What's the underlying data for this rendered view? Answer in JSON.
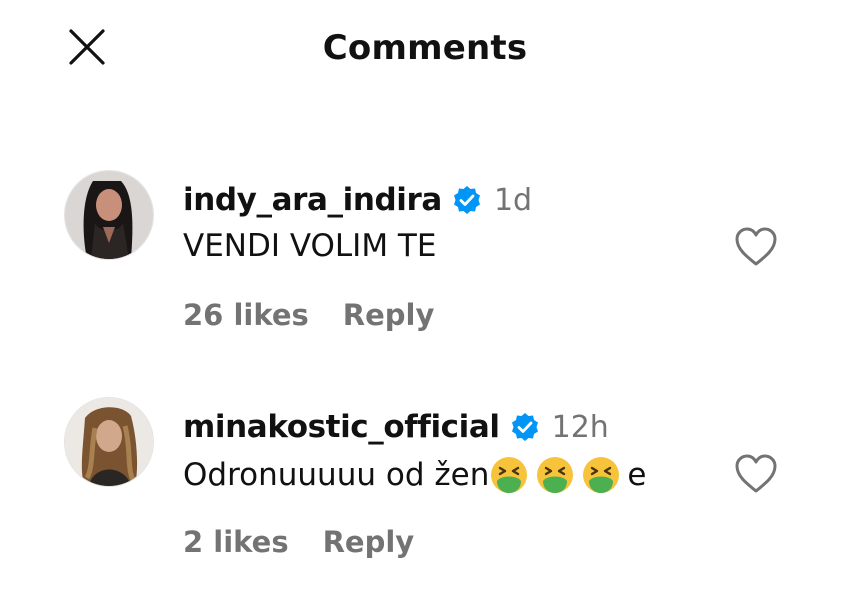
{
  "header": {
    "title": "Comments",
    "close_icon": "close-icon"
  },
  "comments": [
    {
      "username": "indy_ara_indira",
      "verified": true,
      "time": "1d",
      "text": "VENDI VOLIM TE",
      "likes": "26 likes",
      "reply_label": "Reply",
      "avatar_icon": "avatar-photo"
    },
    {
      "username": "minakostic_official",
      "verified": true,
      "time": "12h",
      "text_prefix": "Odronuuuuu od žen",
      "emojis": [
        "nauseated-face",
        "nauseated-face",
        "nauseated-face"
      ],
      "text_suffix": "e",
      "likes": "2 likes",
      "reply_label": "Reply",
      "avatar_icon": "avatar-photo"
    }
  ],
  "colors": {
    "text": "#111111",
    "secondary": "#737373",
    "verified_blue": "#0095f6",
    "emoji_yellow": "#f6c33b",
    "emoji_green": "#4caf50"
  }
}
